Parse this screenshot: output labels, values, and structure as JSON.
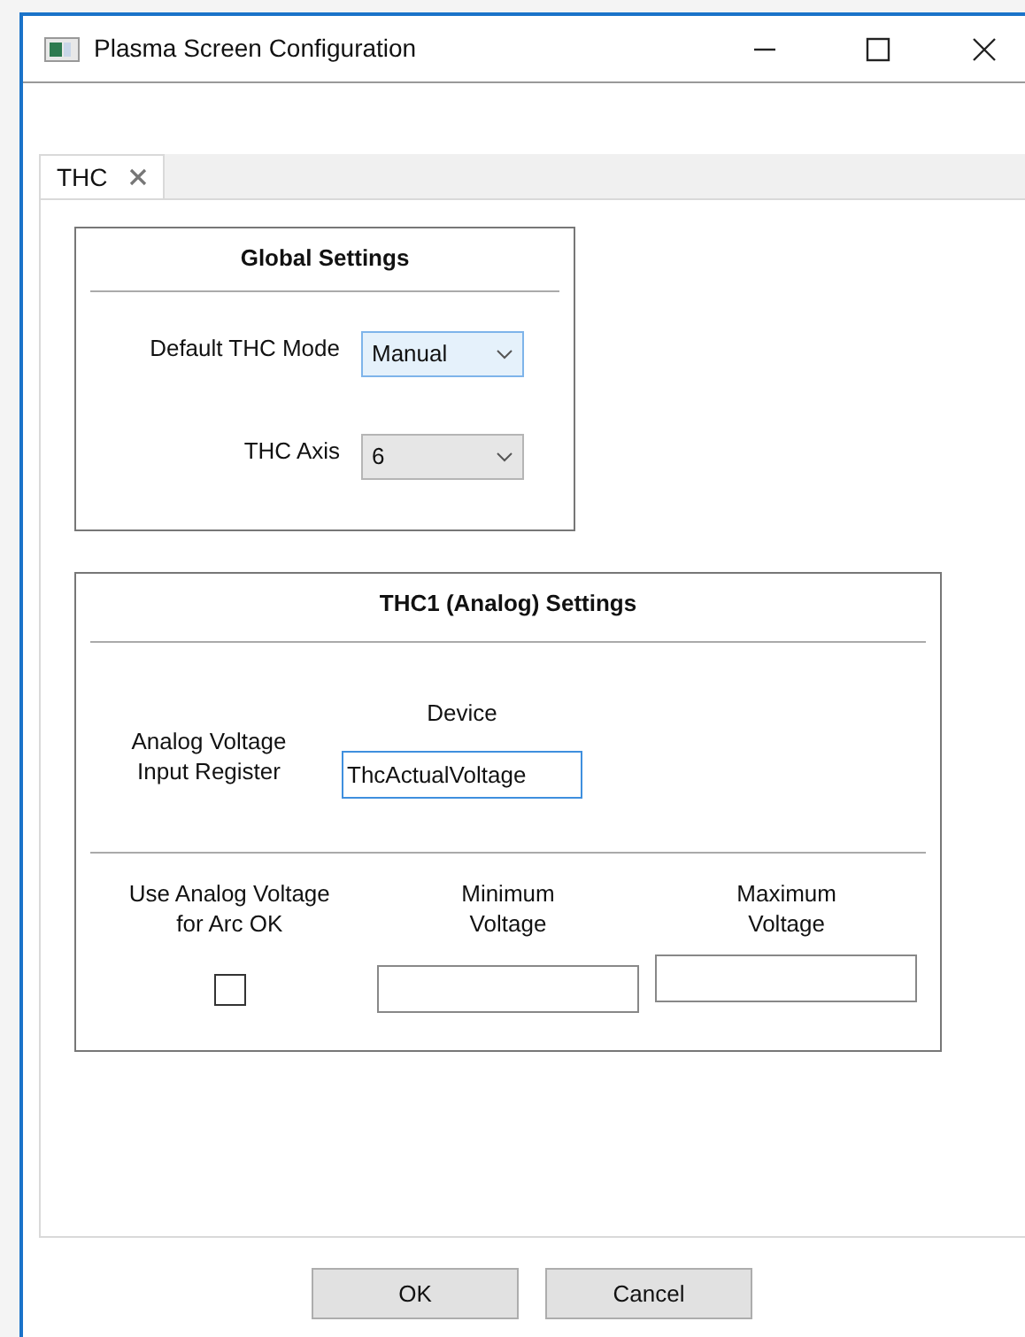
{
  "window": {
    "title": "Plasma Screen Configuration"
  },
  "tabs": [
    {
      "label": "THC",
      "selected": true
    }
  ],
  "global_settings": {
    "title": "Global Settings",
    "fields": [
      {
        "label": "Default THC Mode",
        "value": "Manual",
        "highlighted": true
      },
      {
        "label": "THC Axis",
        "value": "6",
        "highlighted": false
      }
    ]
  },
  "thc1_settings": {
    "title": "THC1 (Analog) Settings",
    "register": {
      "label": "Analog Voltage Input Register",
      "heading": "Device",
      "value": "ThcActualVoltage",
      "focused": true
    },
    "options": [
      {
        "kind": "checkbox",
        "label": "Use Analog Voltage for Arc OK",
        "checked": false
      },
      {
        "kind": "input",
        "label": "Minimum Voltage"
      },
      {
        "kind": "input",
        "label": "Maximum Voltage"
      }
    ]
  },
  "buttons": [
    "OK",
    "Cancel"
  ]
}
